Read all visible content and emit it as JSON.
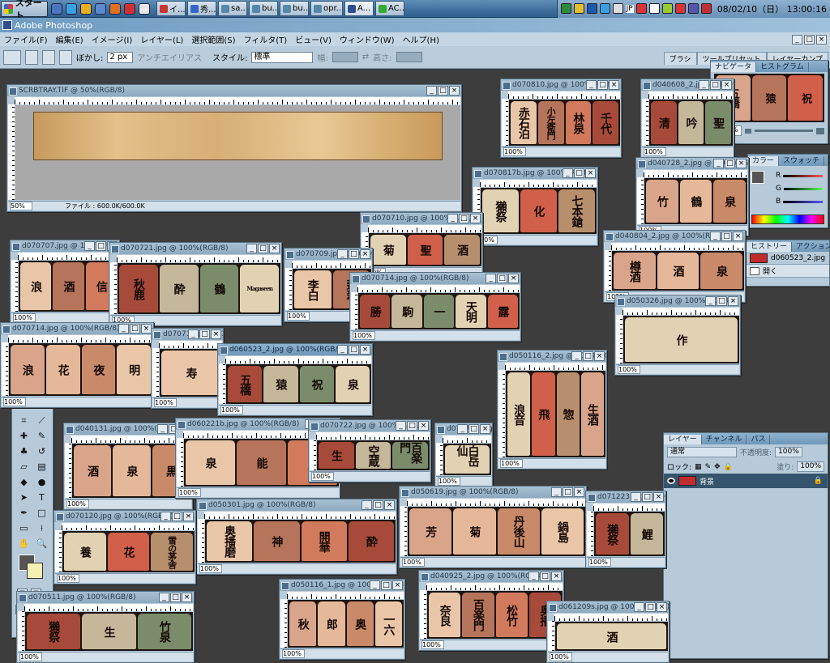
{
  "taskbar": {
    "start_label": "スタート",
    "tasks": [
      {
        "label": "イ..."
      },
      {
        "label": "秀..."
      },
      {
        "label": "sa..."
      },
      {
        "label": "bu..."
      },
      {
        "label": "bu..."
      },
      {
        "label": "opr..."
      },
      {
        "label": "A...",
        "active": true
      },
      {
        "label": "AC..."
      }
    ],
    "tray_jp": "JP",
    "clock": "08/02/10（日） 13:00:16"
  },
  "photoshop": {
    "title": "Adobe Photoshop",
    "menus": [
      "ファイル(F)",
      "編集(E)",
      "イメージ(I)",
      "レイヤー(L)",
      "選択範囲(S)",
      "フィルタ(T)",
      "ビュー(V)",
      "ウィンドウ(W)",
      "ヘルプ(H)"
    ],
    "options": {
      "feather_label": "ぼかし:",
      "feather_value": "2 px",
      "antialias_label": "アンチエイリアス",
      "style_label": "スタイル:",
      "style_value": "標準",
      "width_label": "幅:",
      "height_label": "高さ:"
    },
    "palette_well_tabs": [
      "ブラシ",
      "ツールプリセット",
      "レイヤーカンプ"
    ]
  },
  "documents": [
    {
      "title": "SCRBTRAY.TIF @ 50%(RGB/8)",
      "zoom": "50%",
      "status": "ファイル : 600.0K/600.0K"
    },
    {
      "title": "d070810.jpg @ 100%(RGB/8)",
      "zoom": "100%",
      "labels": [
        "赤石泊",
        "小左衛門",
        "林泉",
        "千代"
      ]
    },
    {
      "title": "d040608_2.jpg @ 100%(RGB/8)",
      "zoom": "100%",
      "labels": [
        "清",
        "吟",
        "聖"
      ]
    },
    {
      "title": "d070817b.jpg @ 100%(RGB/8)",
      "zoom": "100%",
      "labels": [
        "獺祭",
        "化",
        "七本鎗"
      ]
    },
    {
      "title": "d040728_2.jpg @ 100%(RGB/8)",
      "zoom": "100%",
      "labels": [
        "竹",
        "鶴",
        "泉"
      ]
    },
    {
      "title": "d070707.jpg @ 100%(RGB/8)",
      "zoom": "100%",
      "labels": [
        "浪",
        "酒",
        "信"
      ]
    },
    {
      "title": "d070721.jpg @ 100%(RGB/8)",
      "zoom": "100%",
      "labels": [
        "秋鹿",
        "酔",
        "鶴",
        "Magaseen"
      ]
    },
    {
      "title": "d070710.jpg @ 100%(RGB/8)",
      "zoom": "100%",
      "labels": [
        "菊",
        "聖",
        "酒"
      ]
    },
    {
      "title": "d040804_2.jpg @ 100%(RGB/8)",
      "zoom": "100%",
      "labels": [
        "樽酒",
        "酒",
        "泉"
      ]
    },
    {
      "title": "d070709.jpg @ 100%(RGB/8)",
      "zoom": "100%",
      "labels": [
        "李白",
        "翡翠"
      ]
    },
    {
      "title": "d070714.jpg @ 100%(RGB/8)",
      "zoom": "100%",
      "labels": [
        "勝",
        "駒",
        "一",
        "天明",
        "露"
      ]
    },
    {
      "title": "d050326.jpg @ 100%(RGB/8)",
      "zoom": "100%",
      "labels": [
        "作"
      ]
    },
    {
      "title": "d070714.jpg @ 100%(RGB/8)",
      "zoom": "100%",
      "labels": [
        "浪",
        "花",
        "夜",
        "明"
      ]
    },
    {
      "title": "d070719.jpg @ 100%(RGB/8)",
      "zoom": "100%",
      "labels": [
        "寿"
      ]
    },
    {
      "title": "d060523_2.jpg @ 100%(RGB/8)",
      "zoom": "100%",
      "labels": [
        "五橋",
        "猿",
        "祝",
        "泉"
      ],
      "active": true
    },
    {
      "title": "d050116_2.jpg @ 100%(RGB/8)",
      "zoom": "100%",
      "labels": [
        "浪音",
        "飛",
        "惣",
        "生酒"
      ]
    },
    {
      "title": "d040131.jpg @ 100%(RGB/8)",
      "zoom": "100%",
      "labels": [
        "酒",
        "泉",
        "黒"
      ]
    },
    {
      "title": "d060221b.jpg @ 100%(RGB/8)",
      "zoom": "100%",
      "labels": [
        "泉",
        "能",
        "東一"
      ]
    },
    {
      "title": "d070722.jpg @ 100%(RGB/8)",
      "zoom": "100%",
      "labels": [
        "生",
        "空蔵",
        "百楽門"
      ]
    },
    {
      "title": "d070720.jpg @ 100%(RGB/8)",
      "zoom": "100%",
      "labels": [
        "白岳仙"
      ]
    },
    {
      "title": "d050619.jpg @ 100%(RGB/8)",
      "zoom": "100%",
      "labels": [
        "芳",
        "菊",
        "丹後山",
        "鍋島"
      ]
    },
    {
      "title": "d050301.jpg @ 100%(RGB/8)",
      "zoom": "100%",
      "labels": [
        "奥播磨",
        "神",
        "開華",
        "酔"
      ]
    },
    {
      "title": "d071223.jpg @ 100%(RGB/8)",
      "zoom": "100%",
      "labels": [
        "獺祭",
        "鯉"
      ]
    },
    {
      "title": "d070120.jpg @ 100%(RGB/8)",
      "zoom": "100%",
      "labels": [
        "養",
        "花",
        "雪の茅舎"
      ]
    },
    {
      "title": "d050116_1.jpg @ 100%(RGB/8)",
      "zoom": "100%",
      "labels": [
        "秋",
        "郎",
        "奥",
        "一六"
      ]
    },
    {
      "title": "d040925_2.jpg @ 100%(RGB/8)",
      "zoom": "100%",
      "labels": [
        "奈良",
        "百楽門",
        "松竹",
        "奥播"
      ]
    },
    {
      "title": "d070511.jpg @ 100%(RGB/8)",
      "zoom": "100%",
      "labels": [
        "獺祭",
        "生",
        "竹泉"
      ]
    },
    {
      "title": "d061209s.jpg @ 100%(RGB/8)",
      "zoom": "100%",
      "labels": [
        "酒"
      ]
    }
  ],
  "navigator": {
    "tabs": [
      "ナビゲータ",
      "ヒストグラム"
    ],
    "zoom": "100%",
    "labels": [
      "五橋",
      "猿",
      "祝"
    ]
  },
  "color_palette": {
    "tabs": [
      "カラー",
      "スウォッチ",
      "スタイル"
    ],
    "channels": [
      "R",
      "G",
      "B"
    ]
  },
  "history_palette": {
    "tabs": [
      "ヒストリー",
      "アクション"
    ],
    "items": [
      "d060523_2.jpg",
      "開く"
    ]
  },
  "layers_palette": {
    "tabs": [
      "レイヤー",
      "チャンネル",
      "パス"
    ],
    "blend_mode": "通常",
    "opacity_label": "不透明度:",
    "opacity_value": "100%",
    "lock_label": "ロック:",
    "fill_label": "塗り:",
    "fill_value": "100%",
    "layer_name": "背景"
  },
  "colors": {
    "taskbar": "#3f6f9c",
    "workspace": "#3d3d3d",
    "window_frame": "#b6cad9",
    "active_title": "#6f97b8"
  }
}
